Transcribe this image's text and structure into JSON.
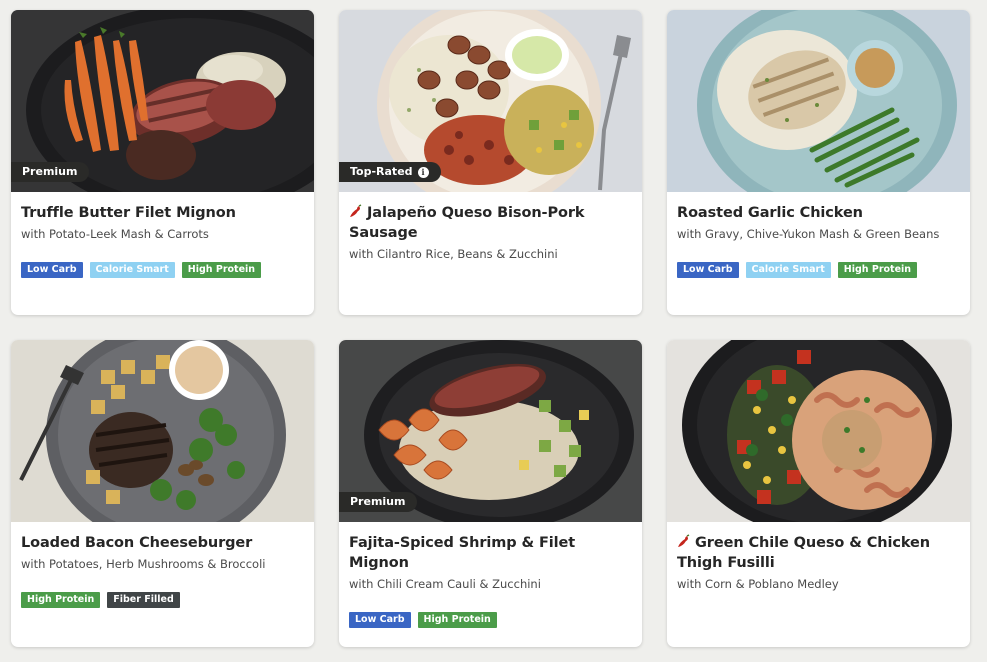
{
  "meals": [
    {
      "title": "Truffle Butter Filet Mignon",
      "subtitle": "with Potato-Leek Mash & Carrots",
      "badge": "Premium",
      "spicy": false,
      "tags": [
        "Low Carb",
        "Calorie Smart",
        "High Protein"
      ]
    },
    {
      "title": "Jalapeño Queso Bison-Pork Sausage",
      "subtitle": "with Cilantro Rice, Beans & Zucchini",
      "badge": "Top-Rated",
      "badge_icon": "i",
      "spicy": true,
      "tags": []
    },
    {
      "title": "Roasted Garlic Chicken",
      "subtitle": "with Gravy, Chive-Yukon Mash & Green Beans",
      "badge": "",
      "spicy": false,
      "tags": [
        "Low Carb",
        "Calorie Smart",
        "High Protein"
      ]
    },
    {
      "title": "Loaded Bacon Cheeseburger",
      "subtitle": "with Potatoes, Herb Mushrooms & Broccoli",
      "badge": "",
      "spicy": false,
      "tags": [
        "High Protein",
        "Fiber Filled"
      ]
    },
    {
      "title": "Fajita-Spiced Shrimp & Filet Mignon",
      "subtitle": "with Chili Cream Cauli & Zucchini",
      "badge": "Premium",
      "spicy": false,
      "tags": [
        "Low Carb",
        "High Protein"
      ]
    },
    {
      "title": "Green Chile Queso & Chicken Thigh Fusilli",
      "subtitle": "with Corn & Poblano Medley",
      "badge": "",
      "spicy": true,
      "tags": []
    }
  ],
  "tag_colors": {
    "Low Carb": "#3a66c4",
    "Calorie Smart": "#8fd1f2",
    "High Protein": "#4b9c49",
    "Fiber Filled": "#404547"
  },
  "icons": {
    "spicy": "chili-pepper-icon",
    "info": "info-icon"
  }
}
